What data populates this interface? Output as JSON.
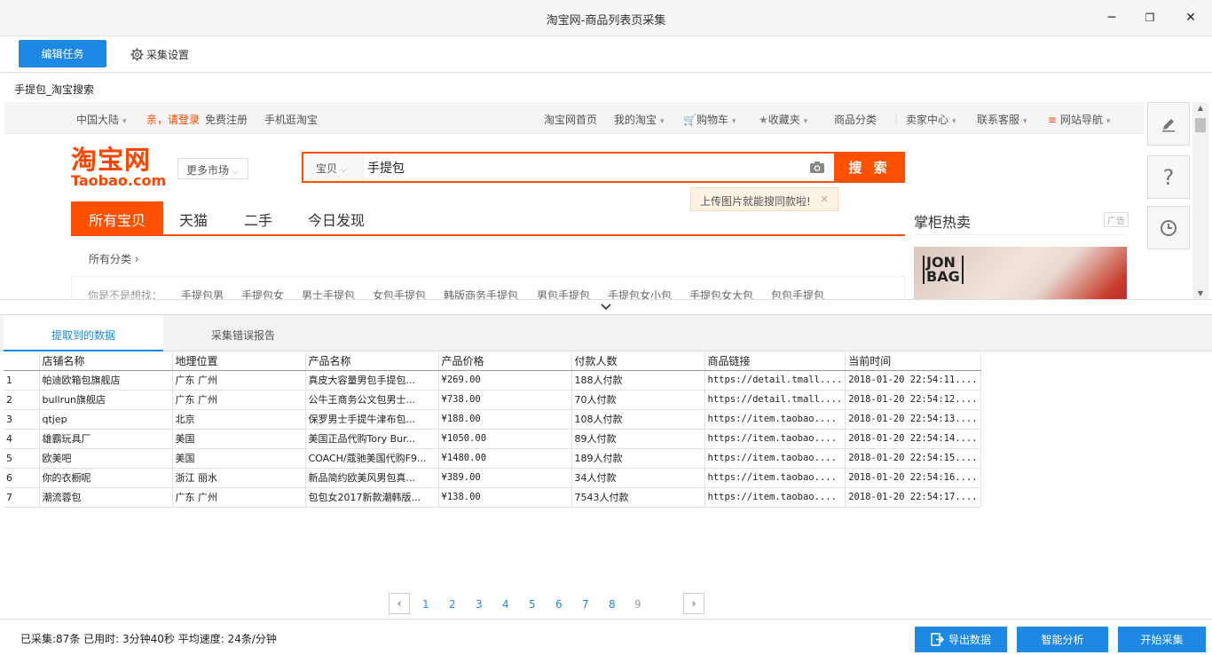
{
  "window": {
    "title": "淘宝网-商品列表页采集",
    "minimize": "─",
    "restore": "❐",
    "close": "✕"
  },
  "toolbar": {
    "edit_task": "编辑任务",
    "settings": "采集设置"
  },
  "browser": {
    "page_title": "手提包_淘宝搜索"
  },
  "taobao": {
    "topnav": {
      "region": "中国大陆",
      "login": "亲，请登录",
      "register": "免费注册",
      "mobile": "手机逛淘宝",
      "home": "淘宝网首页",
      "my_taobao": "我的淘宝",
      "cart": "购物车",
      "favorites": "收藏夹",
      "categories": "商品分类",
      "seller": "卖家中心",
      "service": "联系客服",
      "site_nav": "网站导航"
    },
    "logo": {
      "cn": "淘宝网",
      "en": "Taobao.com"
    },
    "more_market": "更多市场",
    "search": {
      "category": "宝贝",
      "query": "手提包",
      "button": "搜 索"
    },
    "tip": {
      "text": "上传图片就能搜同款啦!",
      "close": "×"
    },
    "tabs": [
      "所有宝贝",
      "天猫",
      "二手",
      "今日发现"
    ],
    "all_categories": "所有分类 ›",
    "guess": {
      "label": "你是不是想找：",
      "items": [
        "手提包男",
        "手提包女",
        "男士手提包",
        "女包手提包",
        "韩版商务手提包",
        "男包手提包",
        "手提包女小包",
        "手提包女大包",
        "包包手提包"
      ]
    },
    "hot": {
      "title": "掌柜热卖",
      "ad": "广告",
      "brand_top": "JON",
      "brand_bottom": "BAG"
    }
  },
  "data_tabs": [
    "提取到的数据",
    "采集错误报告"
  ],
  "table": {
    "columns": [
      "",
      "店铺名称",
      "地理位置",
      "产品名称",
      "产品价格",
      "付款人数",
      "商品链接",
      "当前时间"
    ],
    "rows": [
      [
        "1",
        "帕迪欧箱包旗舰店",
        "广东 广州",
        "真皮大容量男包手提包...",
        "¥269.00",
        "188人付款",
        "https://detail.tmall....",
        "2018-01-20 22:54:11...."
      ],
      [
        "2",
        "bullrun旗舰店",
        "广东 广州",
        "公牛王商务公文包男士...",
        "¥738.00",
        "70人付款",
        "https://detail.tmall....",
        "2018-01-20 22:54:12...."
      ],
      [
        "3",
        "qtjep",
        "北京",
        "保罗男士手提牛津布包...",
        "¥188.00",
        "108人付款",
        "https://item.taobao....",
        "2018-01-20 22:54:13...."
      ],
      [
        "4",
        "雄霸玩具厂",
        "美国",
        "美国正品代购Tory Bur...",
        "¥1050.00",
        "89人付款",
        "https://item.taobao....",
        "2018-01-20 22:54:14...."
      ],
      [
        "5",
        "欧美吧",
        "美国",
        "COACH/蔻驰美国代购F9...",
        "¥1480.00",
        "189人付款",
        "https://item.taobao....",
        "2018-01-20 22:54:15...."
      ],
      [
        "6",
        "你的衣橱呢",
        "浙江 丽水",
        "新品简约欧美风男包真...",
        "¥389.00",
        "34人付款",
        "https://item.taobao....",
        "2018-01-20 22:54:16...."
      ],
      [
        "7",
        "潮流蓉包",
        "广东 广州",
        "包包女2017新款潮韩版...",
        "¥138.00",
        "7543人付款",
        "https://item.taobao....",
        "2018-01-20 22:54:17...."
      ]
    ]
  },
  "pager": {
    "prev": "‹",
    "next": "›",
    "pages": [
      "1",
      "2",
      "3",
      "4",
      "5",
      "6",
      "7",
      "8",
      "9"
    ]
  },
  "status": {
    "text": "已采集:87条  已用时: 3分钟40秒 平均速度: 24条/分钟"
  },
  "actions": {
    "export": "导出数据",
    "analyze": "智能分析",
    "start": "开始采集"
  },
  "colors": {
    "accent": "#1e88e5",
    "taobao_orange": "#ff5000"
  }
}
